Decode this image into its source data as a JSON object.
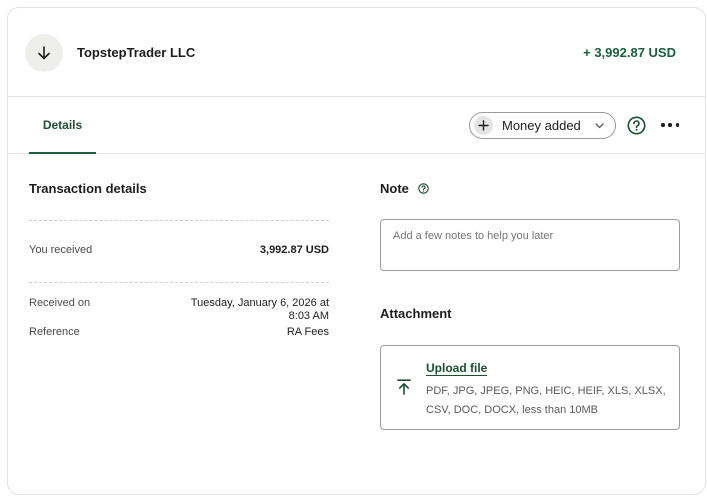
{
  "header": {
    "merchant_name": "TopstepTrader LLC",
    "amount": "+ 3,992.87 USD",
    "avatar_icon": "arrow-down-icon"
  },
  "tabs": [
    {
      "label": "Details",
      "active": true
    }
  ],
  "toolbar": {
    "category_label": "Money added",
    "category_icon": "plus-icon",
    "help_icon": "question-circle-icon",
    "more_icon": "more-horizontal-icon"
  },
  "transaction": {
    "title": "Transaction details",
    "received_label": "You received",
    "received_value": "3,992.87 USD",
    "received_on_label": "Received on",
    "received_on_line1": "Tuesday, January 6, 2026 at",
    "received_on_line2": "8:03 AM",
    "reference_label": "Reference",
    "reference_value": "RA Fees"
  },
  "note": {
    "title": "Note",
    "placeholder": "Add a few notes to help you later"
  },
  "attachment": {
    "title": "Attachment",
    "upload_label": "Upload file",
    "file_types": "PDF, JPG, JPEG, PNG, HEIC, HEIF, XLS, XLSX, CSV, DOC, DOCX, less than 10MB"
  },
  "colors": {
    "accent_green": "#1b5e3a",
    "border": "#e6e6e6"
  }
}
